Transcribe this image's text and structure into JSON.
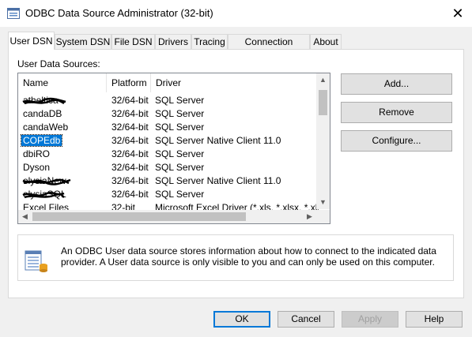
{
  "window": {
    "title": "ODBC Data Source Administrator (32-bit)"
  },
  "tabs": [
    {
      "label": "User DSN",
      "active": true
    },
    {
      "label": "System DSN"
    },
    {
      "label": "File DSN"
    },
    {
      "label": "Drivers"
    },
    {
      "label": "Tracing"
    },
    {
      "label": "Connection Pooling"
    },
    {
      "label": "About"
    }
  ],
  "section_label": "User Data Sources:",
  "columns": [
    "Name",
    "Platform",
    "Driver"
  ],
  "rows": [
    {
      "name": "atheltica",
      "platform": "32/64-bit",
      "driver": "SQL Server",
      "redacted": true
    },
    {
      "name": "candaDB",
      "platform": "32/64-bit",
      "driver": "SQL Server"
    },
    {
      "name": "candaWeb",
      "platform": "32/64-bit",
      "driver": "SQL Server"
    },
    {
      "name": "COPEdb",
      "platform": "32/64-bit",
      "driver": "SQL Server Native Client 11.0",
      "selected": true
    },
    {
      "name": "dbiRO",
      "platform": "32/64-bit",
      "driver": "SQL Server"
    },
    {
      "name": "Dyson",
      "platform": "32/64-bit",
      "driver": "SQL Server"
    },
    {
      "name": "elysiaNew",
      "platform": "32/64-bit",
      "driver": "SQL Server Native Client 11.0",
      "redacted": true
    },
    {
      "name": "elysiaSQL",
      "platform": "32/64-bit",
      "driver": "SQL Server",
      "redacted": true
    },
    {
      "name": "Excel Files",
      "platform": "32-bit",
      "driver": "Microsoft Excel Driver (*.xls, *.xlsx, *.xlsm, *.xlsb)"
    }
  ],
  "side_buttons": {
    "add": "Add...",
    "remove": "Remove",
    "configure": "Configure..."
  },
  "info_text": "An ODBC User data source stores information about how to connect to the indicated data provider.   A User data source is only visible to you and can only be used on this computer.",
  "bottom_buttons": {
    "ok": "OK",
    "cancel": "Cancel",
    "apply": "Apply",
    "help": "Help"
  },
  "icons": {
    "title": "odbc-app-icon",
    "info": "data-source-icon",
    "close": "close-icon"
  },
  "colors": {
    "selection": "#0078d7",
    "default_button_border": "#0078d7"
  }
}
